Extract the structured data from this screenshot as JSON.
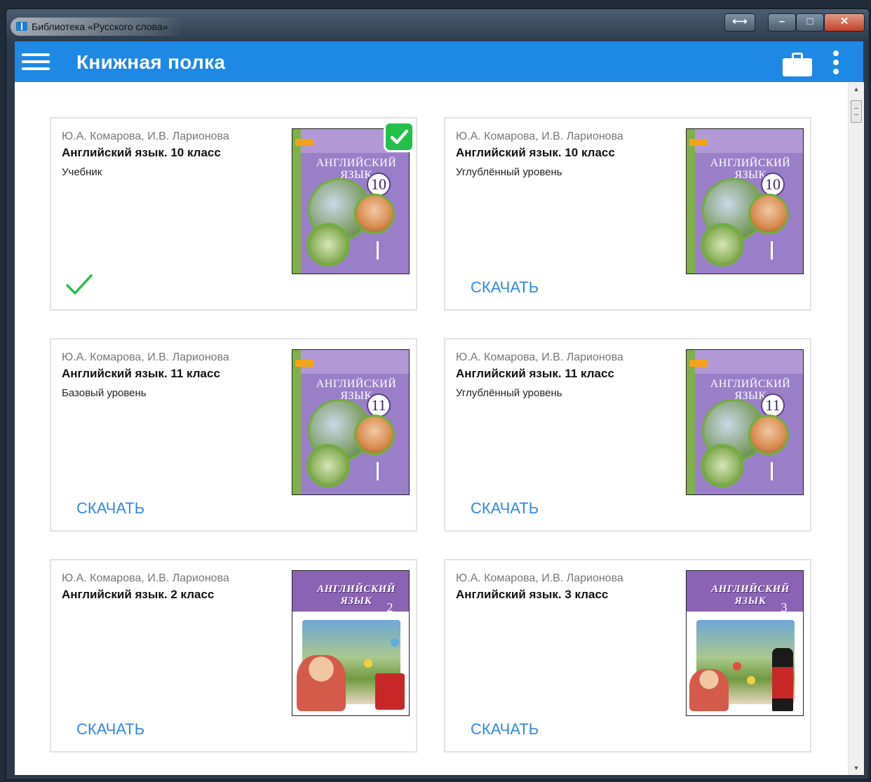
{
  "window": {
    "title": "Библиотека «Русского слова»",
    "icons": {
      "app": "book-icon",
      "resize": "resize-arrows-icon",
      "minimize": "minimize-icon",
      "maximize": "maximize-icon",
      "close": "close-icon"
    },
    "buttons": {
      "resize_glyph": "⟷",
      "minimize_glyph": "–",
      "maximize_glyph": "□",
      "close_glyph": "✕"
    }
  },
  "appbar": {
    "title": "Книжная полка",
    "color": "#1e88e5",
    "icons": {
      "menu": "hamburger-menu-icon",
      "briefcase": "briefcase-icon",
      "more": "more-vertical-icon"
    }
  },
  "scrollbar": {
    "up_glyph": "▲",
    "down_glyph": "▼"
  },
  "accent_download": "#2f89e4",
  "accent_done": "#23c14a",
  "books": [
    {
      "authors": "Ю.А. Комарова, И.В. Ларионова",
      "title": "Английский язык. 10 класс",
      "subtitle": "Учебник",
      "status": "downloaded",
      "cover_title": "АНГЛИЙСКИЙ ЯЗЫК",
      "cover_grade": "10"
    },
    {
      "authors": "Ю.А. Комарова, И.В. Ларионова",
      "title": "Английский язык. 10 класс",
      "subtitle": "Углублённый уровень",
      "action": "СКАЧАТЬ",
      "cover_title": "АНГЛИЙСКИЙ ЯЗЫК",
      "cover_grade": "10"
    },
    {
      "authors": "Ю.А. Комарова, И.В. Ларионова",
      "title": "Английский язык. 11 класс",
      "subtitle": "Базовый уровень",
      "action": "СКАЧАТЬ",
      "cover_title": "АНГЛИЙСКИЙ ЯЗЫК",
      "cover_grade": "11"
    },
    {
      "authors": "Ю.А. Комарова, И.В. Ларионова",
      "title": "Английский язык. 11 класс",
      "subtitle": "Углублённый уровень",
      "action": "СКАЧАТЬ",
      "cover_title": "АНГЛИЙСКИЙ ЯЗЫК",
      "cover_grade": "11"
    },
    {
      "authors": "Ю.А. Комарова, И.В. Ларионова",
      "title": "Английский язык. 2 класс",
      "action": "СКАЧАТЬ",
      "cover_title": "АНГЛИЙСКИЙ ЯЗЫК",
      "cover_grade": "2"
    },
    {
      "authors": "Ю.А. Комарова, И.В. Ларионова",
      "title": "Английский язык. 3 класс",
      "action": "СКАЧАТЬ",
      "cover_title": "АНГЛИЙСКИЙ ЯЗЫК",
      "cover_grade": "3"
    }
  ]
}
